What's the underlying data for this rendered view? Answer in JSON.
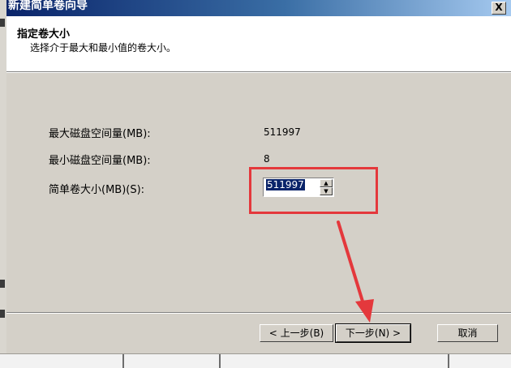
{
  "window": {
    "title": "新建简单卷向导",
    "close_label": "X"
  },
  "header": {
    "title": "指定卷大小",
    "subtitle": "选择介于最大和最小值的卷大小。"
  },
  "fields": {
    "max_label": "最大磁盘空间量(MB):",
    "max_value": "511997",
    "min_label": "最小磁盘空间量(MB):",
    "min_value": "8",
    "size_label": "简单卷大小(MB)(S):",
    "size_value": "511997"
  },
  "buttons": {
    "back": "< 上一步(B)",
    "next": "下一步(N) >",
    "cancel": "取消"
  },
  "annotation": {
    "highlight_color": "#e4383c"
  }
}
